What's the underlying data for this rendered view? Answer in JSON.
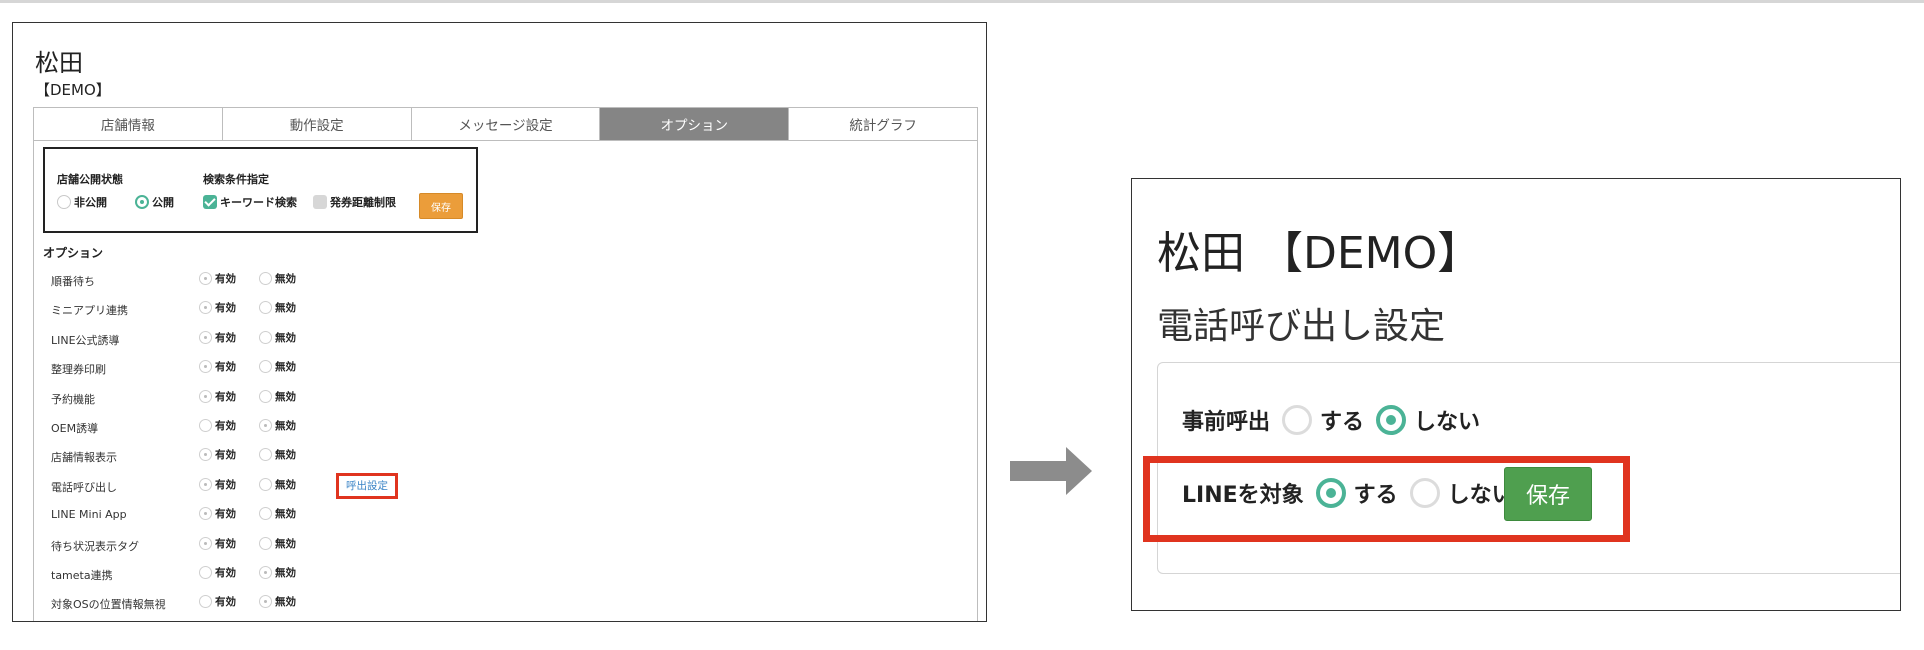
{
  "left": {
    "store_name": "松田",
    "demo_label": "【DEMO】",
    "tabs": [
      {
        "label": "店舗情報",
        "active": false
      },
      {
        "label": "動作設定",
        "active": false
      },
      {
        "label": "メッセージ設定",
        "active": false
      },
      {
        "label": "オプション",
        "active": true
      },
      {
        "label": "統計グラフ",
        "active": false
      }
    ],
    "status_box": {
      "public_label": "店舗公開状態",
      "private_option": "非公開",
      "public_option": "公開",
      "public_selected": "公開",
      "search_label": "検索条件指定",
      "keyword_search": "キーワード検索",
      "keyword_checked": true,
      "distance_limit": "発券距離制限",
      "distance_checked": false,
      "save_label": "保存"
    },
    "options_heading": "オプション",
    "options": [
      {
        "name": "順番待ち",
        "enabled_label": "有効",
        "disabled_label": "無効",
        "selected": "有効"
      },
      {
        "name": "ミニアプリ連携",
        "enabled_label": "有効",
        "disabled_label": "無効",
        "selected": "有効"
      },
      {
        "name": "LINE公式誘導",
        "enabled_label": "有効",
        "disabled_label": "無効",
        "selected": "有効"
      },
      {
        "name": "整理券印刷",
        "enabled_label": "有効",
        "disabled_label": "無効",
        "selected": "有効"
      },
      {
        "name": "予約機能",
        "enabled_label": "有効",
        "disabled_label": "無効",
        "selected": "有効"
      },
      {
        "name": "OEM誘導",
        "enabled_label": "有効",
        "disabled_label": "無効",
        "selected": "無効"
      },
      {
        "name": "店舗情報表示",
        "enabled_label": "有効",
        "disabled_label": "無効",
        "selected": "有効"
      },
      {
        "name": "電話呼び出し",
        "enabled_label": "有効",
        "disabled_label": "無効",
        "selected": "有効",
        "link": "呼出設定"
      },
      {
        "name": "LINE Mini App",
        "enabled_label": "有効",
        "disabled_label": "無効",
        "selected": "有効"
      },
      {
        "name": "待ち状況表示タグ",
        "enabled_label": "有効",
        "disabled_label": "無効",
        "selected": "有効"
      },
      {
        "name": "tameta連携",
        "enabled_label": "有効",
        "disabled_label": "無効",
        "selected": "無効"
      },
      {
        "name": "対象OSの位置情報無視",
        "enabled_label": "有効",
        "disabled_label": "無効",
        "selected": "無効"
      }
    ]
  },
  "right": {
    "title": "松田 【DEMO】",
    "subtitle": "電話呼び出し設定",
    "pre_call_label": "事前呼出",
    "pre_call_yes": "する",
    "pre_call_no": "しない",
    "pre_call_selected": "しない",
    "line_label": "LINEを対象",
    "line_yes": "する",
    "line_no": "しない",
    "line_selected": "する",
    "save_label": "保存"
  },
  "colors": {
    "accent_green": "#4bb396",
    "save_orange": "#eb9d3a",
    "save_green": "#4f9f4f",
    "highlight_red": "#e0341f",
    "active_tab_gray": "#858585",
    "link_blue": "#3a84c6"
  },
  "icons": {
    "arrow": "right-arrow-icon"
  }
}
